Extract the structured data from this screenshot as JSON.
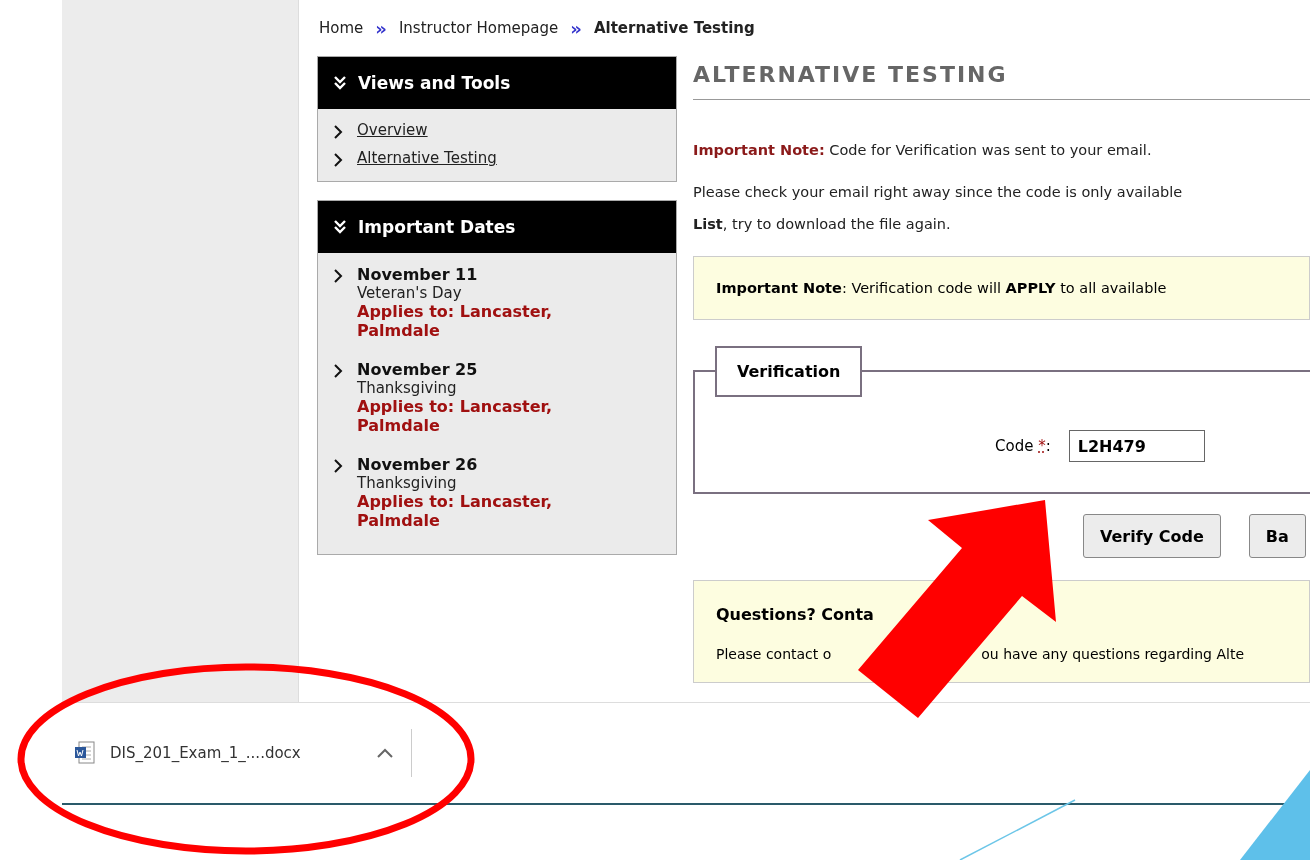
{
  "breadcrumb": [
    {
      "label": "Home",
      "current": false
    },
    {
      "label": "Instructor Homepage",
      "current": false
    },
    {
      "label": "Alternative Testing",
      "current": true
    }
  ],
  "breadcrumb_separator": "»",
  "sidebar": {
    "panels": [
      {
        "kind": "links",
        "title": "Views and Tools",
        "items": [
          {
            "label": "Overview"
          },
          {
            "label": "Alternative Testing"
          }
        ]
      },
      {
        "kind": "dates",
        "title": "Important Dates",
        "items": [
          {
            "date": "November 11",
            "event": "Veteran's Day",
            "applies": "Applies to: Lancaster, Palmdale"
          },
          {
            "date": "November 25",
            "event": "Thanksgiving",
            "applies": "Applies to: Lancaster, Palmdale"
          },
          {
            "date": "November 26",
            "event": "Thanksgiving",
            "applies": "Applies to: Lancaster, Palmdale"
          }
        ]
      }
    ]
  },
  "main": {
    "title": "ALTERNATIVE TESTING",
    "note_label": "Important Note:",
    "note_text": " Code for Verification was sent to your email.",
    "paragraph": "Please check your email right away since the code is only available",
    "paragraph_line2": "**List**, try to download the file again.",
    "notice": "**Important Note**: Verification code will **APPLY** to all available",
    "fieldset": {
      "legend": "Verification",
      "label": "Code",
      "required_mark": "*",
      "colon": ":",
      "value": "L2H479"
    },
    "buttons": [
      "Verify Code",
      "Ba"
    ],
    "contact": {
      "heading": "Questions? Conta",
      "text_before": "Please contact o",
      "text_after": "ou have any questions regarding Alte"
    }
  },
  "downloads": [
    {
      "file": "DIS_201_Exam_1_....docx"
    }
  ]
}
